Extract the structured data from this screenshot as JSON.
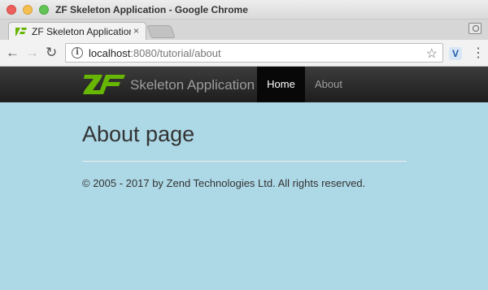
{
  "window": {
    "title": "ZF Skeleton Application - Google Chrome"
  },
  "tabs": {
    "active_title": "ZF Skeleton Application",
    "close_glyph": "×"
  },
  "toolbar": {
    "url_host": "localhost",
    "url_rest": ":8080/tutorial/about",
    "extension_label": "V"
  },
  "navbar": {
    "brand": "Skeleton Application",
    "items": [
      {
        "label": "Home",
        "active": true
      },
      {
        "label": "About",
        "active": false
      }
    ]
  },
  "page": {
    "title": "About page",
    "footer": "© 2005 - 2017 by Zend Technologies Ltd. All rights reserved."
  },
  "colors": {
    "page_background": "#add8e6",
    "navbar_background": "#222222",
    "logo_green": "#68b604"
  },
  "icons": [
    "info-icon",
    "star-icon",
    "back-arrow-icon",
    "forward-arrow-icon",
    "reload-icon",
    "menu-icon",
    "zf-logo"
  ]
}
